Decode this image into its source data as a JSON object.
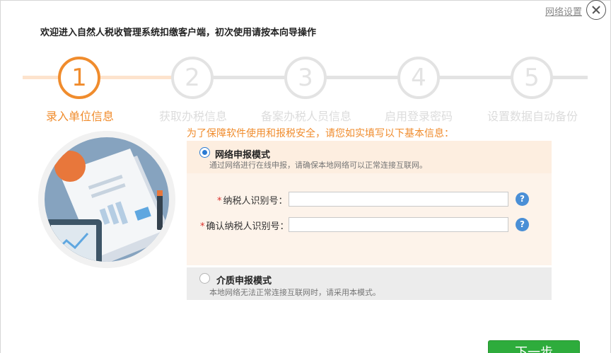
{
  "header": {
    "network_settings": "网络设置",
    "close_icon": "close-icon",
    "welcome": "欢迎进入自然人税收管理系统扣缴客户端，初次使用请按本向导操作"
  },
  "steps": [
    {
      "number": "1",
      "label": "录入单位信息",
      "active": true
    },
    {
      "number": "2",
      "label": "获取办税信息",
      "active": false
    },
    {
      "number": "3",
      "label": "备案办税人员信息",
      "active": false
    },
    {
      "number": "4",
      "label": "启用登录密码",
      "active": false
    },
    {
      "number": "5",
      "label": "设置数据自动备份",
      "active": false
    }
  ],
  "form": {
    "notice": "为了保障软件使用和报税安全，请您如实填写以下基本信息：",
    "network_mode": {
      "title": "网络申报模式",
      "desc": "通过网络进行在线申报，请确保本地网络可以正常连接互联网。",
      "selected": true
    },
    "taxpayer_id": {
      "required_mark": "*",
      "label": "纳税人识别号：",
      "value": ""
    },
    "confirm_taxpayer_id": {
      "required_mark": "*",
      "label": "确认纳税人识别号：",
      "value": ""
    },
    "help_glyph": "?",
    "media_mode": {
      "title": "介质申报模式",
      "desc": "本地网络无法正常连接互联网时，请采用本模式。",
      "selected": false
    }
  },
  "footer": {
    "next_label": "下一步"
  },
  "colors": {
    "accent": "#f08c2d",
    "primary_button": "#2eac3c",
    "radio": "#2a7ad3",
    "help": "#4a8fd6"
  }
}
